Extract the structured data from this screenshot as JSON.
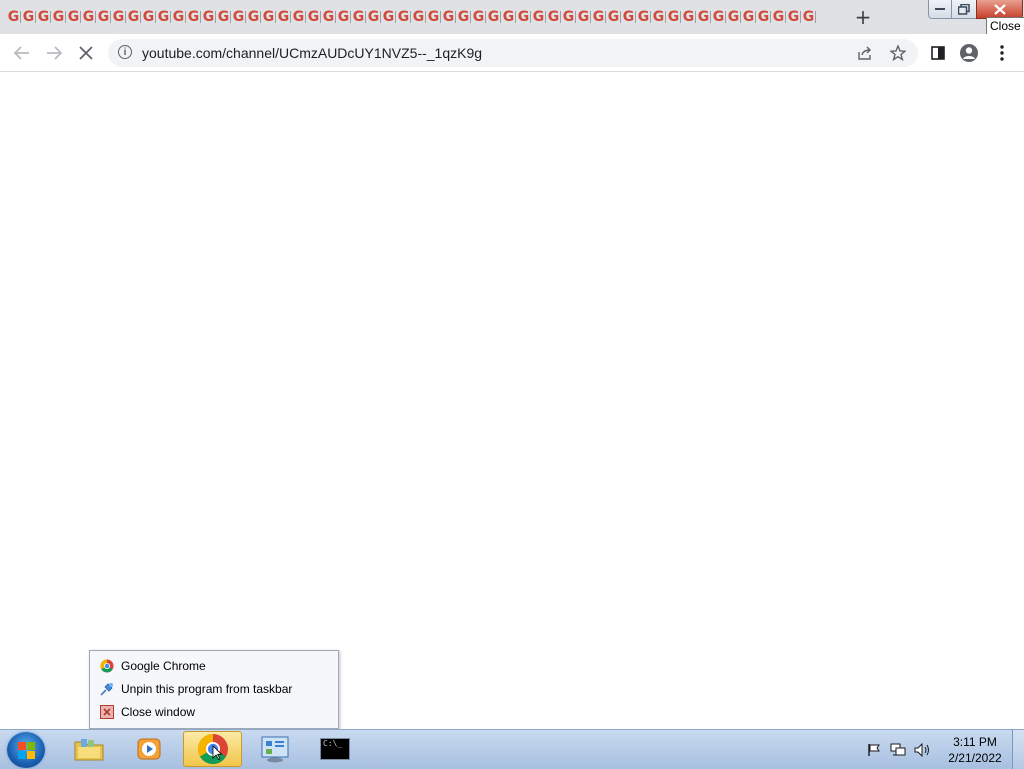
{
  "browser": {
    "tab_favicon_letter": "G",
    "tab_count": 54,
    "new_tab_label": "+",
    "address_url": "youtube.com/channel/UCmzAUDcUY1NVZ5--_1qzK9g",
    "tooltip": "Close",
    "icons": [
      "back-icon",
      "forward-icon",
      "stop-loading-icon",
      "site-info-icon",
      "share-icon",
      "bookmark-star-icon",
      "side-panel-icon",
      "profile-icon",
      "menu-icon"
    ]
  },
  "jumplist": {
    "items": [
      {
        "label": "Google Chrome",
        "icon": "chrome-icon"
      },
      {
        "label": "Unpin this program from taskbar",
        "icon": "unpin-icon"
      },
      {
        "label": "Close window",
        "icon": "close-window-icon"
      }
    ]
  },
  "taskbar": {
    "cmd_label": "C:\\_",
    "clock_time": "3:11 PM",
    "clock_date": "2/21/2022"
  },
  "colors": {
    "tabstrip": "#dfe1e5",
    "accent_close": "#c8402b",
    "taskbar": "#b9cdea"
  }
}
